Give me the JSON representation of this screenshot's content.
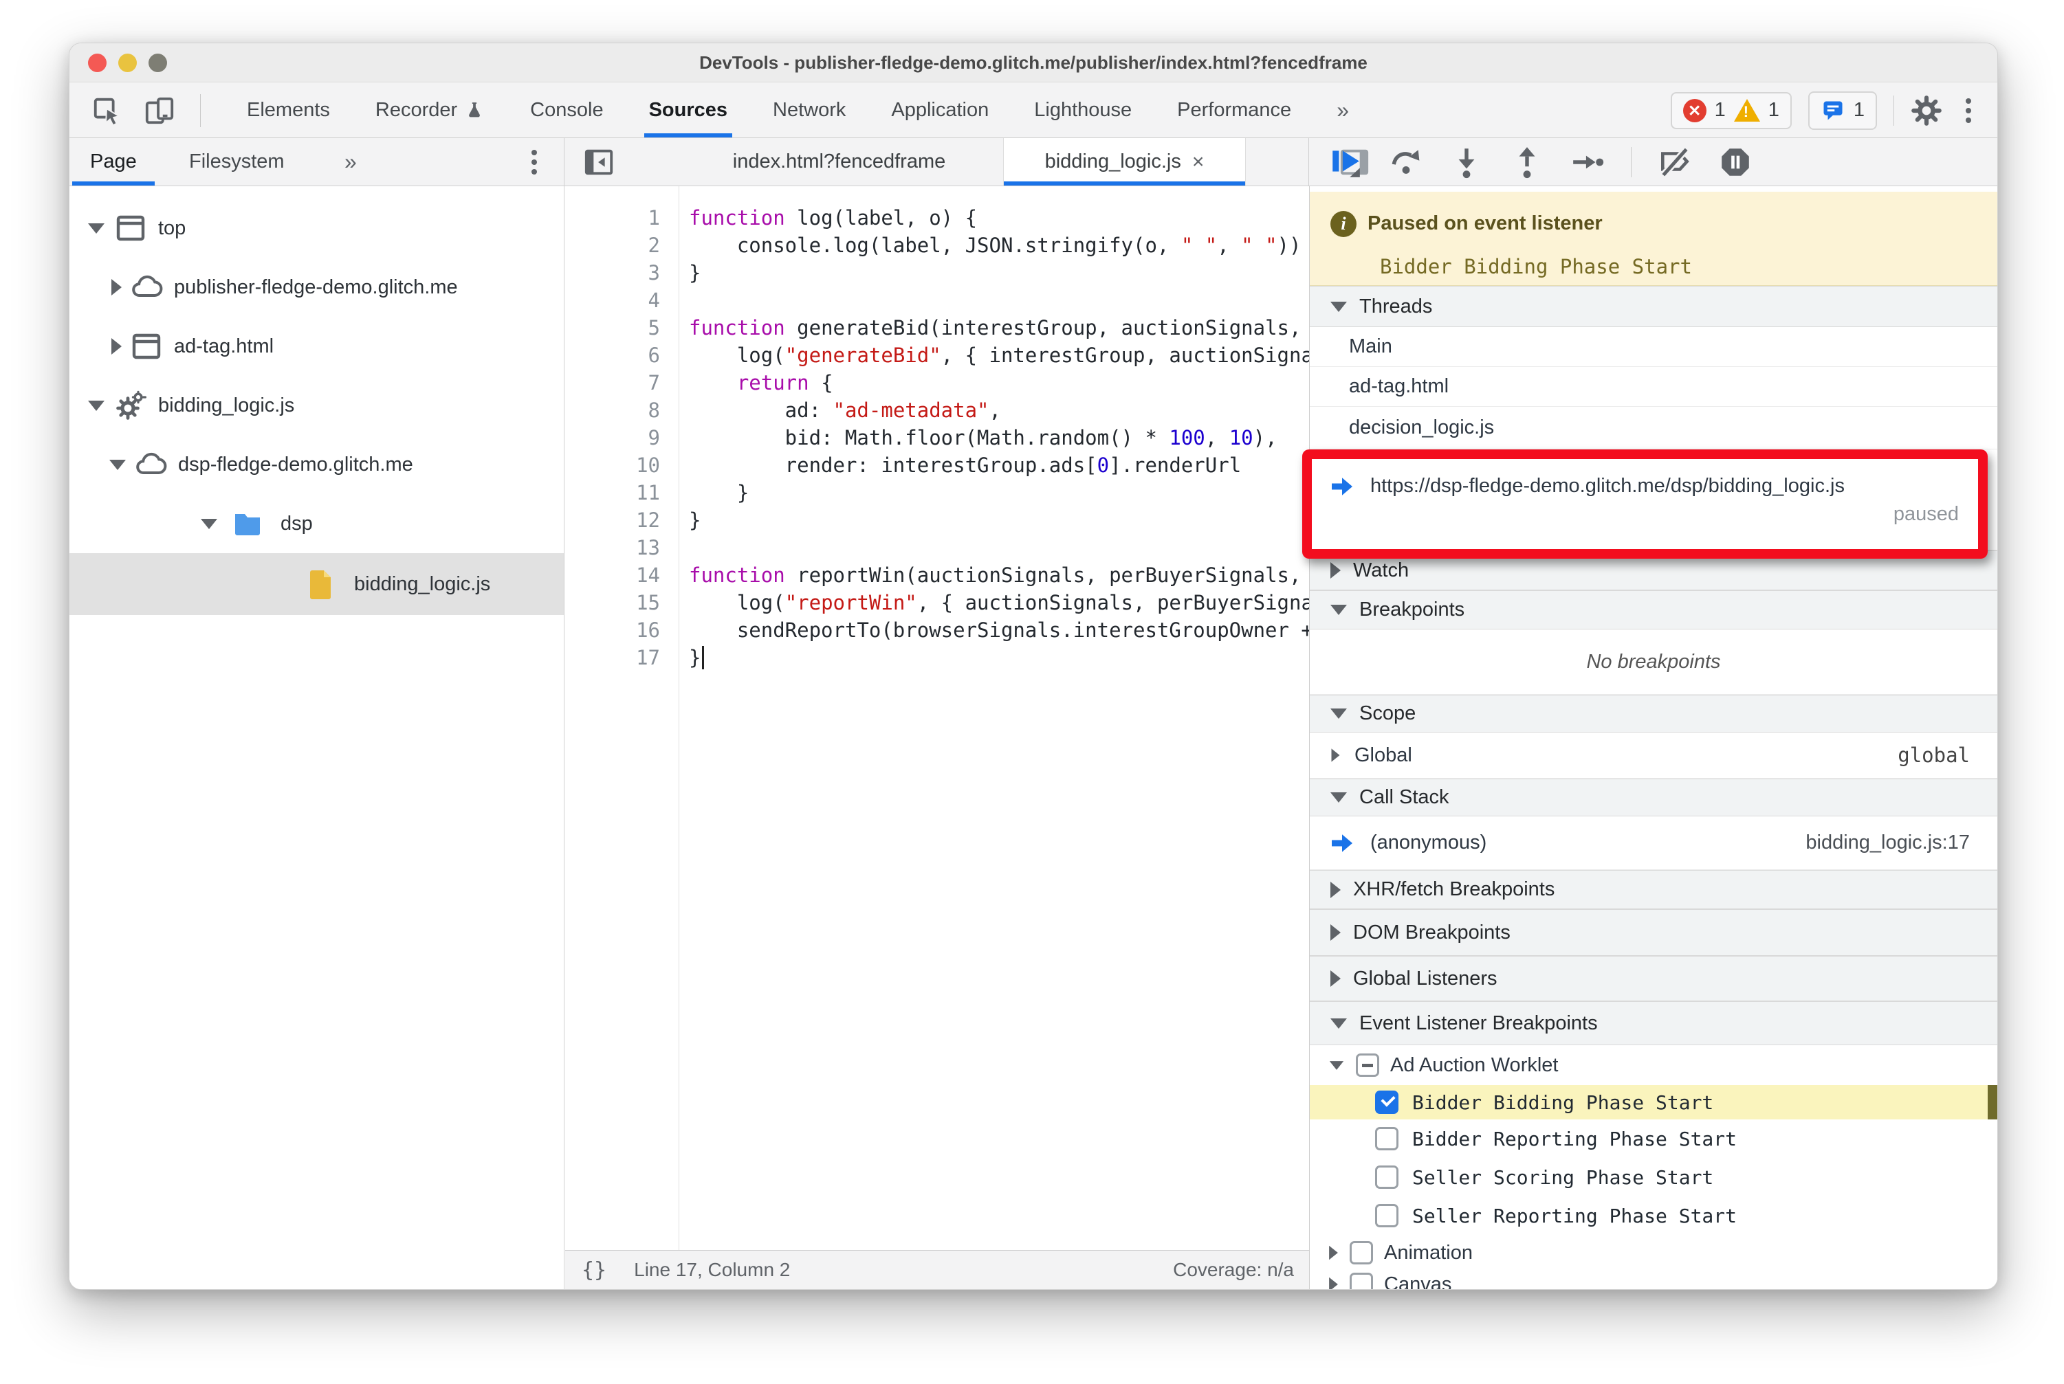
{
  "window": {
    "title": "DevTools - publisher-fledge-demo.glitch.me/publisher/index.html?fencedframe"
  },
  "icons": {
    "double_chevron": "»",
    "close": "×",
    "error_x": "✕",
    "pretty_print": "{}"
  },
  "main_toolbar": {
    "tabs": [
      {
        "label": "Elements"
      },
      {
        "label": "Recorder"
      },
      {
        "label": "Console"
      },
      {
        "label": "Sources"
      },
      {
        "label": "Network"
      },
      {
        "label": "Application"
      },
      {
        "label": "Lighthouse"
      },
      {
        "label": "Performance"
      }
    ],
    "active_tab": "Sources",
    "error_count": "1",
    "warning_count": "1",
    "issues_count": "1"
  },
  "sidebar": {
    "tabs": [
      {
        "label": "Page"
      },
      {
        "label": "Filesystem"
      }
    ],
    "active_tab": "Page",
    "tree": [
      {
        "label": "top"
      },
      {
        "label": "publisher-fledge-demo.glitch.me"
      },
      {
        "label": "ad-tag.html"
      },
      {
        "label": "bidding_logic.js"
      },
      {
        "label": "dsp-fledge-demo.glitch.me"
      },
      {
        "label": "dsp"
      },
      {
        "label": "bidding_logic.js",
        "selected": true
      }
    ]
  },
  "editor": {
    "tabs": [
      {
        "label": "index.html?fencedframe"
      },
      {
        "label": "bidding_logic.js",
        "active": true
      }
    ],
    "status": {
      "position": "Line 17, Column 2",
      "coverage": "Coverage: n/a"
    },
    "lines": [
      {
        "n": "1",
        "tokens": [
          {
            "v": "function"
          },
          {
            "v": " log(label, o) {"
          }
        ]
      },
      {
        "n": "2",
        "tokens": [
          {
            "v": "    console.log(label, JSON.stringify(o, "
          },
          {
            "v": "\" \""
          },
          {
            "v": ", "
          },
          {
            "v": "\" \""
          },
          {
            "v": "))"
          }
        ]
      },
      {
        "n": "3",
        "tokens": [
          {
            "v": "}"
          }
        ]
      },
      {
        "n": "4",
        "tokens": []
      },
      {
        "n": "5",
        "tokens": [
          {
            "v": "function"
          },
          {
            "v": " generateBid(interestGroup, auctionSignals, perBuyerSignals, trustedBiddingSignals, browserSignals) {"
          }
        ]
      },
      {
        "n": "6",
        "tokens": [
          {
            "v": "    log("
          },
          {
            "v": "\"generateBid\""
          },
          {
            "v": ", { interestGroup, auctionSignals, perBuyerSignals });"
          }
        ]
      },
      {
        "n": "7",
        "tokens": [
          {
            "v": "    "
          },
          {
            "v": "return"
          },
          {
            "v": " {"
          }
        ]
      },
      {
        "n": "8",
        "tokens": [
          {
            "v": "        ad: "
          },
          {
            "v": "\"ad-metadata\""
          },
          {
            "v": ","
          }
        ]
      },
      {
        "n": "9",
        "tokens": [
          {
            "v": "        bid: Math.floor(Math.random() * "
          },
          {
            "v": "100"
          },
          {
            "v": ", "
          },
          {
            "v": "10"
          },
          {
            "v": "),"
          }
        ]
      },
      {
        "n": "10",
        "tokens": [
          {
            "v": "        render: interestGroup.ads["
          },
          {
            "v": "0"
          },
          {
            "v": "].renderUrl"
          }
        ]
      },
      {
        "n": "11",
        "tokens": [
          {
            "v": "    }"
          }
        ]
      },
      {
        "n": "12",
        "tokens": [
          {
            "v": "}"
          }
        ]
      },
      {
        "n": "13",
        "tokens": []
      },
      {
        "n": "14",
        "tokens": [
          {
            "v": "function"
          },
          {
            "v": " reportWin(auctionSignals, perBuyerSignals, sellerSignals, browserSignals) {"
          }
        ]
      },
      {
        "n": "15",
        "tokens": [
          {
            "v": "    log("
          },
          {
            "v": "\"reportWin\""
          },
          {
            "v": ", { auctionSignals, perBuyerSignals, sellerSignals, browserSignals });"
          }
        ]
      },
      {
        "n": "16",
        "tokens": [
          {
            "v": "    sendReportTo(browserSignals.interestGroupOwner + browserSignals.interestGroupName);"
          }
        ]
      },
      {
        "n": "17",
        "tokens": [
          {
            "v": "}"
          }
        ]
      }
    ]
  },
  "debugger": {
    "paused": {
      "title": "Paused on event listener",
      "detail": "Bidder Bidding Phase Start"
    },
    "threads": {
      "title": "Threads",
      "items": [
        {
          "label": "Main"
        },
        {
          "label": "ad-tag.html"
        },
        {
          "label": "decision_logic.js"
        }
      ],
      "paused_thread": {
        "label": "https://dsp-fledge-demo.glitch.me/dsp/bidding_logic.js",
        "status": "paused"
      }
    },
    "watch": {
      "title": "Watch"
    },
    "breakpoints": {
      "title": "Breakpoints",
      "empty": "No breakpoints"
    },
    "scope": {
      "title": "Scope",
      "items": [
        {
          "name": "Global",
          "value": "global"
        }
      ]
    },
    "call_stack": {
      "title": "Call Stack",
      "frames": [
        {
          "name": "(anonymous)",
          "location": "bidding_logic.js:17"
        }
      ]
    },
    "xhr": {
      "title": "XHR/fetch Breakpoints"
    },
    "dom": {
      "title": "DOM Breakpoints"
    },
    "global_listeners": {
      "title": "Global Listeners"
    },
    "event_listener_breakpoints": {
      "title": "Event Listener Breakpoints",
      "group": {
        "label": "Ad Auction Worklet"
      },
      "items": [
        {
          "label": "Bidder Bidding Phase Start",
          "checked": true,
          "highlighted": true
        },
        {
          "label": "Bidder Reporting Phase Start",
          "checked": false
        },
        {
          "label": "Seller Scoring Phase Start",
          "checked": false
        },
        {
          "label": "Seller Reporting Phase Start",
          "checked": false
        }
      ],
      "categories": [
        {
          "label": "Animation"
        },
        {
          "label": "Canvas"
        }
      ]
    }
  }
}
